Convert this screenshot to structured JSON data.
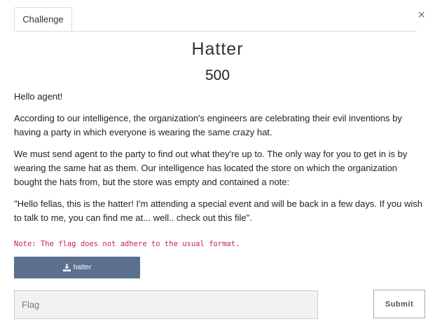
{
  "tabs": [
    {
      "label": "Challenge"
    }
  ],
  "close_glyph": "×",
  "challenge": {
    "name": "Hatter",
    "points": "500",
    "description": [
      "Hello agent!",
      "According to our intelligence, the organization's engineers are celebrating their evil inventions by having a party in which everyone is wearing the same crazy hat.",
      "We must send agent to the party to find out what they're up to. The only way for you to get in is by wearing the same hat as them. Our intelligence has located the store on which the organization bought the hats from, but the store was empty and contained a note:",
      "\"Hello fellas, this is the hatter! I'm attending a special event and will be back in a few days. If you wish to talk to me, you can find me at... well.. check out this file\"."
    ],
    "note": "Note: The flag does not adhere to the usual format.",
    "file_label": "hatter",
    "file_icon": "download-icon"
  },
  "form": {
    "flag_placeholder": "Flag",
    "flag_value": "",
    "submit_label": "Submit"
  },
  "colors": {
    "download_button": "#5b6f8f",
    "note_text": "#c7254e",
    "input_bg": "#f2f2f2"
  }
}
